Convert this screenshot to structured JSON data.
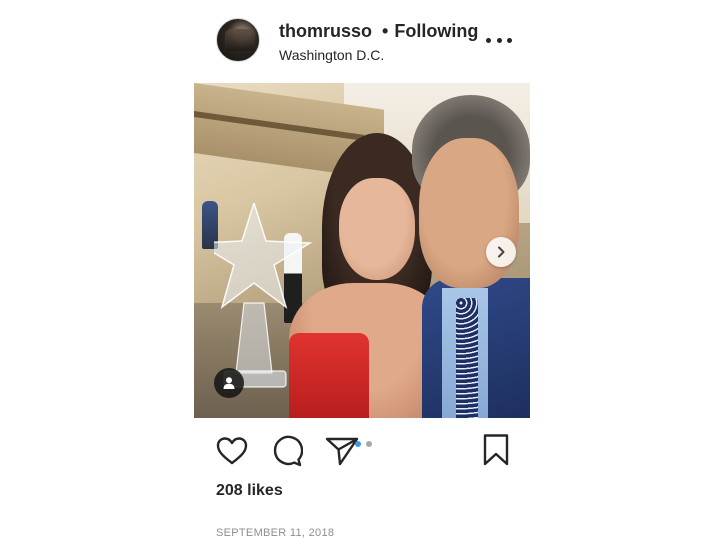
{
  "post": {
    "username": "thomrusso",
    "separator": "•",
    "follow_status": "Following",
    "location": "Washington D.C.",
    "likes": "208 likes",
    "timestamp": "SEPTEMBER 11, 2018",
    "carousel": {
      "total_slides": 2,
      "active_index": 0
    }
  },
  "colors": {
    "accent": "#3897f0",
    "text": "#262626",
    "muted": "#8e8e8e",
    "background": "#ffffff"
  },
  "icons": {
    "more": "more-options-icon",
    "like": "heart-icon",
    "comment": "comment-icon",
    "share": "paper-plane-icon",
    "save": "bookmark-icon",
    "user_tag": "user-tag-icon",
    "next": "chevron-right-icon"
  }
}
